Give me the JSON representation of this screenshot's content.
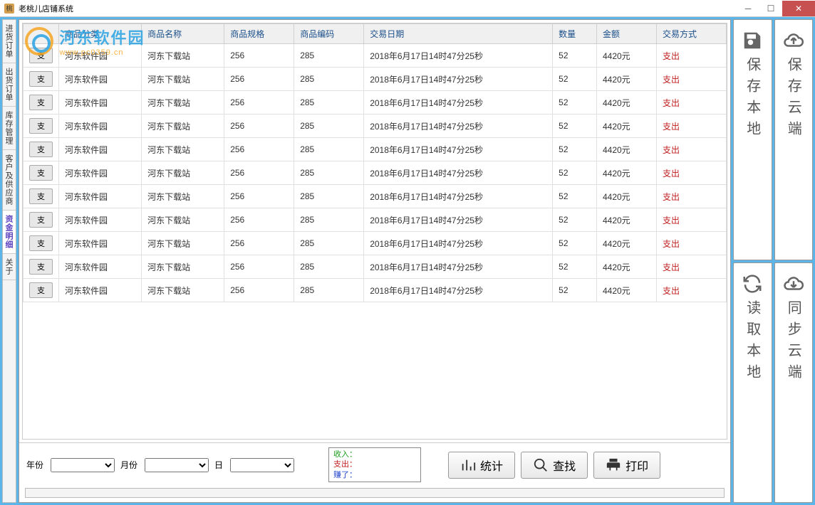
{
  "window": {
    "title": "老桃儿店铺系统"
  },
  "watermark": {
    "name": "河东软件园",
    "url": "www.pc0359.cn"
  },
  "left_nav": {
    "items": [
      {
        "label": "进货订单",
        "active": false
      },
      {
        "label": "出货订单",
        "active": false
      },
      {
        "label": "库存管理",
        "active": false
      },
      {
        "label": "客户及供应商",
        "active": false
      },
      {
        "label": "资金明细",
        "active": true
      },
      {
        "label": "关于",
        "active": false
      }
    ]
  },
  "table": {
    "headers": {
      "col0": "",
      "category": "商品分类",
      "name": "商品名称",
      "spec": "商品规格",
      "code": "商品编码",
      "date": "交易日期",
      "qty": "数量",
      "amount": "金额",
      "txn": "交易方式"
    },
    "row_button": "支",
    "rows": [
      {
        "category": "河东软件园",
        "name": "河东下载站",
        "spec": "256",
        "code": "285",
        "date": "2018年6月17日14时47分25秒",
        "qty": "52",
        "amount": "4420元",
        "txn": "支出"
      },
      {
        "category": "河东软件园",
        "name": "河东下载站",
        "spec": "256",
        "code": "285",
        "date": "2018年6月17日14时47分25秒",
        "qty": "52",
        "amount": "4420元",
        "txn": "支出"
      },
      {
        "category": "河东软件园",
        "name": "河东下载站",
        "spec": "256",
        "code": "285",
        "date": "2018年6月17日14时47分25秒",
        "qty": "52",
        "amount": "4420元",
        "txn": "支出"
      },
      {
        "category": "河东软件园",
        "name": "河东下载站",
        "spec": "256",
        "code": "285",
        "date": "2018年6月17日14时47分25秒",
        "qty": "52",
        "amount": "4420元",
        "txn": "支出"
      },
      {
        "category": "河东软件园",
        "name": "河东下载站",
        "spec": "256",
        "code": "285",
        "date": "2018年6月17日14时47分25秒",
        "qty": "52",
        "amount": "4420元",
        "txn": "支出"
      },
      {
        "category": "河东软件园",
        "name": "河东下载站",
        "spec": "256",
        "code": "285",
        "date": "2018年6月17日14时47分25秒",
        "qty": "52",
        "amount": "4420元",
        "txn": "支出"
      },
      {
        "category": "河东软件园",
        "name": "河东下载站",
        "spec": "256",
        "code": "285",
        "date": "2018年6月17日14时47分25秒",
        "qty": "52",
        "amount": "4420元",
        "txn": "支出"
      },
      {
        "category": "河东软件园",
        "name": "河东下载站",
        "spec": "256",
        "code": "285",
        "date": "2018年6月17日14时47分25秒",
        "qty": "52",
        "amount": "4420元",
        "txn": "支出"
      },
      {
        "category": "河东软件园",
        "name": "河东下载站",
        "spec": "256",
        "code": "285",
        "date": "2018年6月17日14时47分25秒",
        "qty": "52",
        "amount": "4420元",
        "txn": "支出"
      },
      {
        "category": "河东软件园",
        "name": "河东下载站",
        "spec": "256",
        "code": "285",
        "date": "2018年6月17日14时47分25秒",
        "qty": "52",
        "amount": "4420元",
        "txn": "支出"
      },
      {
        "category": "河东软件园",
        "name": "河东下载站",
        "spec": "256",
        "code": "285",
        "date": "2018年6月17日14时47分25秒",
        "qty": "52",
        "amount": "4420元",
        "txn": "支出"
      }
    ]
  },
  "filters": {
    "year_label": "年份",
    "month_label": "月份",
    "day_label": "日"
  },
  "summary": {
    "income_label": "收入：",
    "expense_label": "支出：",
    "earn_label": "赚了："
  },
  "actions": {
    "stats": "统计",
    "search": "查找",
    "print": "打印"
  },
  "right_panel": {
    "save_local": "保存本地",
    "save_cloud": "保存云端",
    "read_local": "读取本地",
    "sync_cloud": "同步云端"
  }
}
